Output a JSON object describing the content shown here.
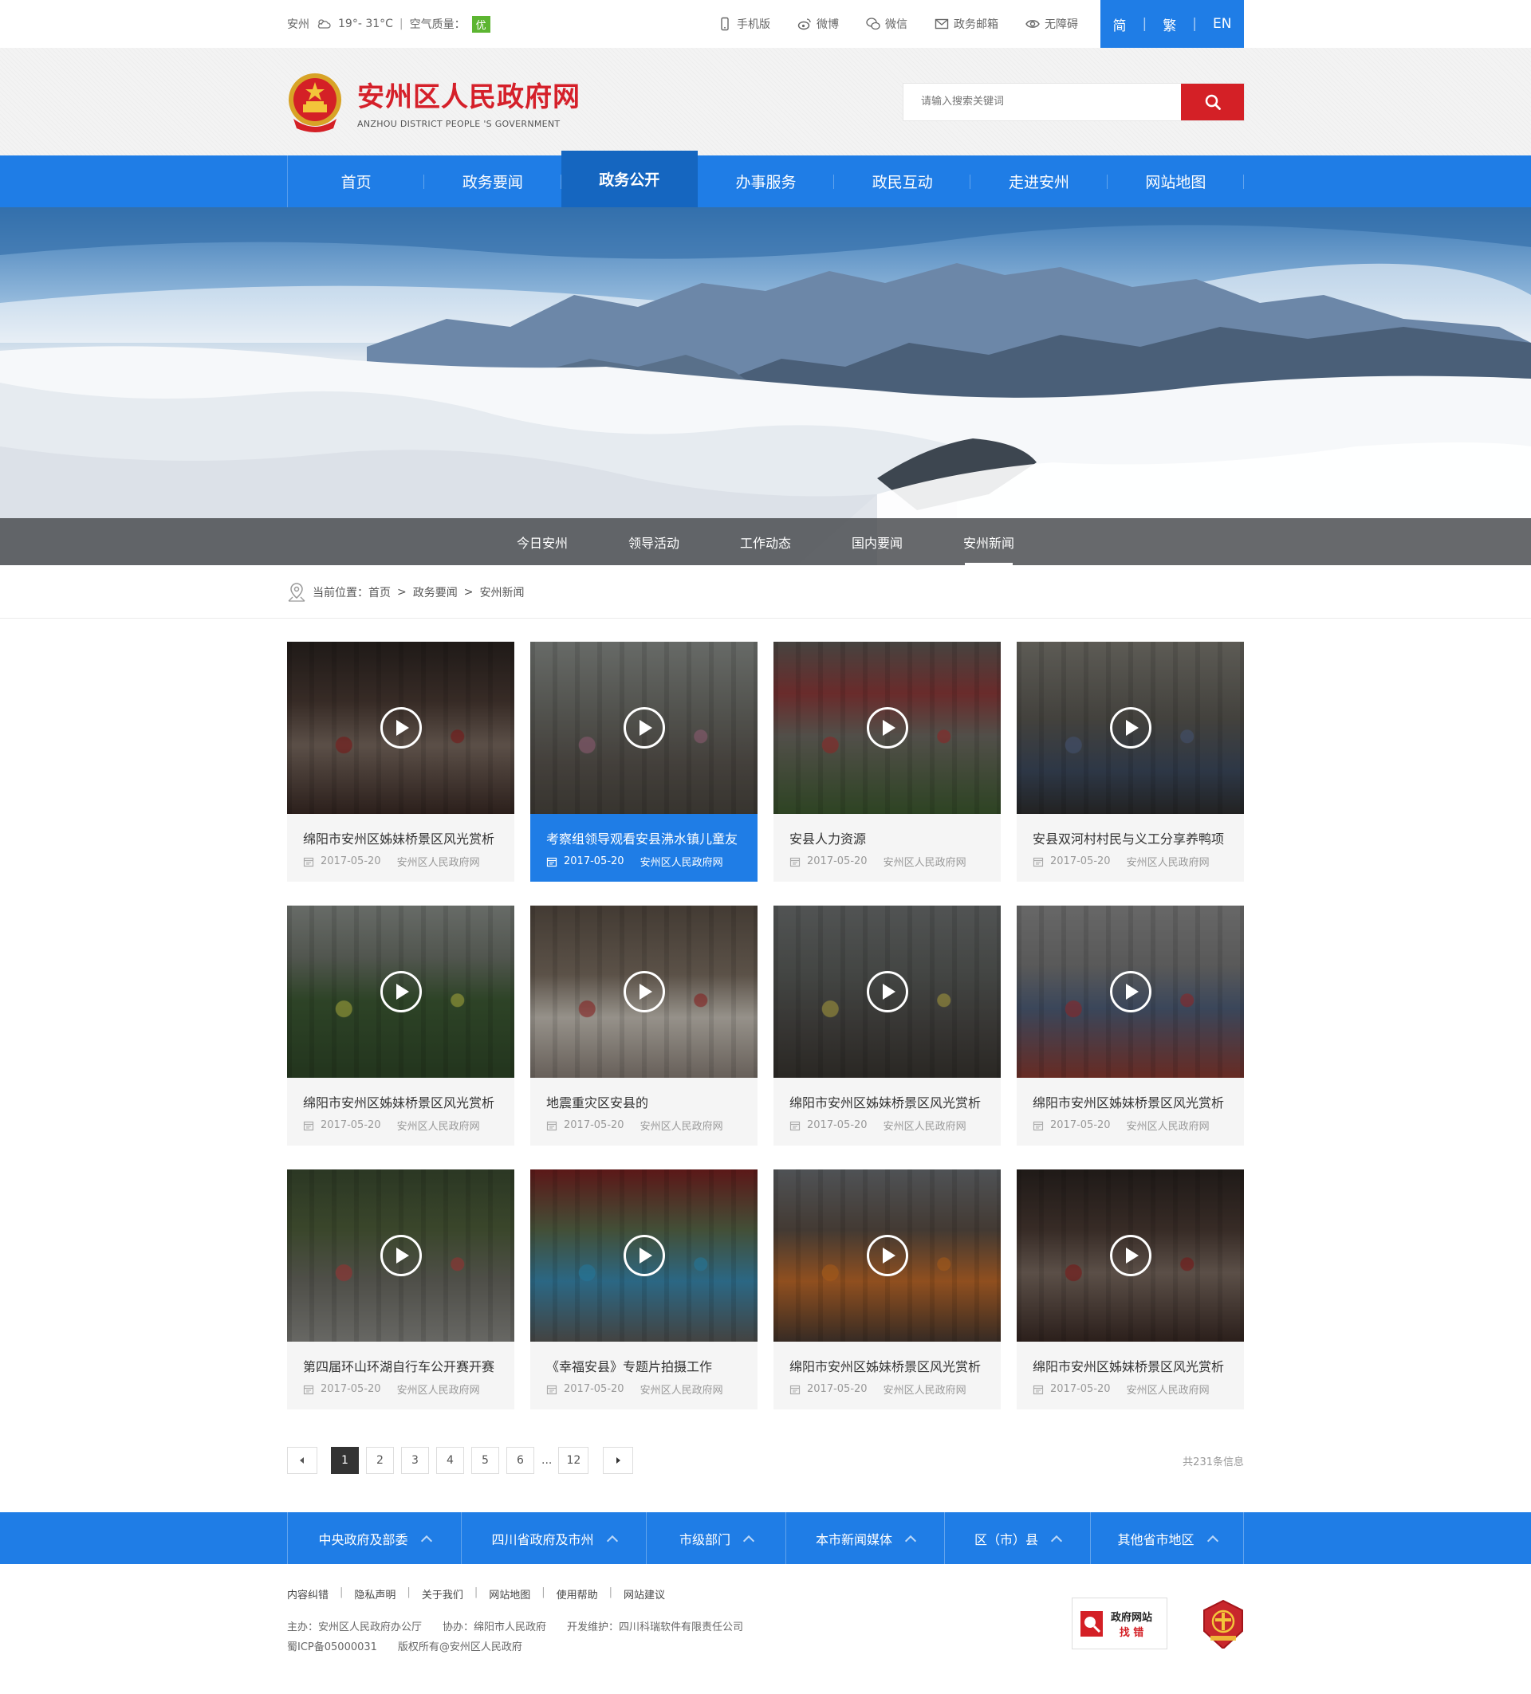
{
  "topbar": {
    "city": "安州",
    "temperature": "19°- 31°C",
    "separator": "|",
    "air_quality_label": "空气质量：",
    "air_quality_value": "优",
    "links": [
      {
        "label": "手机版",
        "icon": "mobile-icon"
      },
      {
        "label": "微博",
        "icon": "weibo-icon"
      },
      {
        "label": "微信",
        "icon": "wechat-icon"
      },
      {
        "label": "政务邮箱",
        "icon": "mail-icon"
      },
      {
        "label": "无障碍",
        "icon": "eye-icon"
      }
    ],
    "lang": {
      "simplified": "简",
      "traditional": "繁",
      "english": "EN",
      "sep": "|"
    }
  },
  "header": {
    "title_cn": "安州区人民政府网",
    "title_en": "ANZHOU DISTRICT PEOPLE 'S GOVERNMENT",
    "search_placeholder": "请输入搜索关键词"
  },
  "nav": {
    "items": [
      "首页",
      "政务要闻",
      "政务公开",
      "办事服务",
      "政民互动",
      "走进安州",
      "网站地图"
    ],
    "active_index": 2
  },
  "subnav": {
    "items": [
      "今日安州",
      "领导活动",
      "工作动态",
      "国内要闻",
      "安州新闻"
    ],
    "active_index": 4
  },
  "breadcrumb": {
    "prefix": "当前位置：",
    "path": [
      "首页",
      "政务要闻",
      "安州新闻"
    ],
    "separator": ">"
  },
  "cards": [
    {
      "title": "绵阳市安州区姊妹桥景区风光赏析",
      "date": "2017-05-20",
      "source": "安州区人民政府网",
      "highlight": false,
      "theme": "dark-gate"
    },
    {
      "title": "考察组领导观看安县沸水镇儿童友",
      "date": "2017-05-20",
      "source": "安州区人民政府网",
      "highlight": true,
      "theme": "people"
    },
    {
      "title": "安县人力资源",
      "date": "2017-05-20",
      "source": "安州区人民政府网",
      "highlight": false,
      "theme": "hall"
    },
    {
      "title": "安县双河村村民与义工分享养鸭项",
      "date": "2017-05-20",
      "source": "安州区人民政府网",
      "highlight": false,
      "theme": "village"
    },
    {
      "title": "绵阳市安州区姊妹桥景区风光赏析",
      "date": "2017-05-20",
      "source": "安州区人民政府网",
      "highlight": false,
      "theme": "field"
    },
    {
      "title": "地震重灾区安县的",
      "date": "2017-05-20",
      "source": "安州区人民政府网",
      "highlight": false,
      "theme": "office"
    },
    {
      "title": "绵阳市安州区姊妹桥景区风光赏析",
      "date": "2017-05-20",
      "source": "安州区人民政府网",
      "highlight": false,
      "theme": "street"
    },
    {
      "title": "绵阳市安州区姊妹桥景区风光赏析",
      "date": "2017-05-20",
      "source": "安州区人民政府网",
      "highlight": false,
      "theme": "stadium"
    },
    {
      "title": "第四届环山环湖自行车公开赛开赛",
      "date": "2017-05-20",
      "source": "安州区人民政府网",
      "highlight": false,
      "theme": "bikes"
    },
    {
      "title": "《幸福安县》专题片拍摄工作",
      "date": "2017-05-20",
      "source": "安州区人民政府网",
      "highlight": false,
      "theme": "dance"
    },
    {
      "title": "绵阳市安州区姊妹桥景区风光赏析",
      "date": "2017-05-20",
      "source": "安州区人民政府网",
      "highlight": false,
      "theme": "parade"
    },
    {
      "title": "绵阳市安州区姊妹桥景区风光赏析",
      "date": "2017-05-20",
      "source": "安州区人民政府网",
      "highlight": false,
      "theme": "dark-gate"
    }
  ],
  "pager": {
    "pages": [
      "1",
      "2",
      "3",
      "4",
      "5",
      "6"
    ],
    "ellipsis": "...",
    "last": "12",
    "active": "1",
    "total": "共231条信息"
  },
  "footer_bar": [
    "中央政府及部委",
    "四川省政府及市州",
    "市级部门",
    "本市新闻媒体",
    "区（市）县",
    "其他省市地区"
  ],
  "footer": {
    "links": [
      "内容纠错",
      "隐私声明",
      "关于我们",
      "网站地图",
      "使用帮助",
      "网站建议"
    ],
    "host": "主办：安州区人民政府办公厅",
    "co": "协办：绵阳市人民政府",
    "dev": "开发维护：四川科瑞软件有限责任公司",
    "icp": "蜀ICP备05000031",
    "copyright": "版权所有@安州区人民政府",
    "badge_line1": "政府网站",
    "badge_line2": "找 错"
  },
  "colors": {
    "primary": "#1f7de6",
    "nav_active": "#1566c0",
    "brand_red": "#d42026",
    "aq_green": "#5cb531"
  }
}
